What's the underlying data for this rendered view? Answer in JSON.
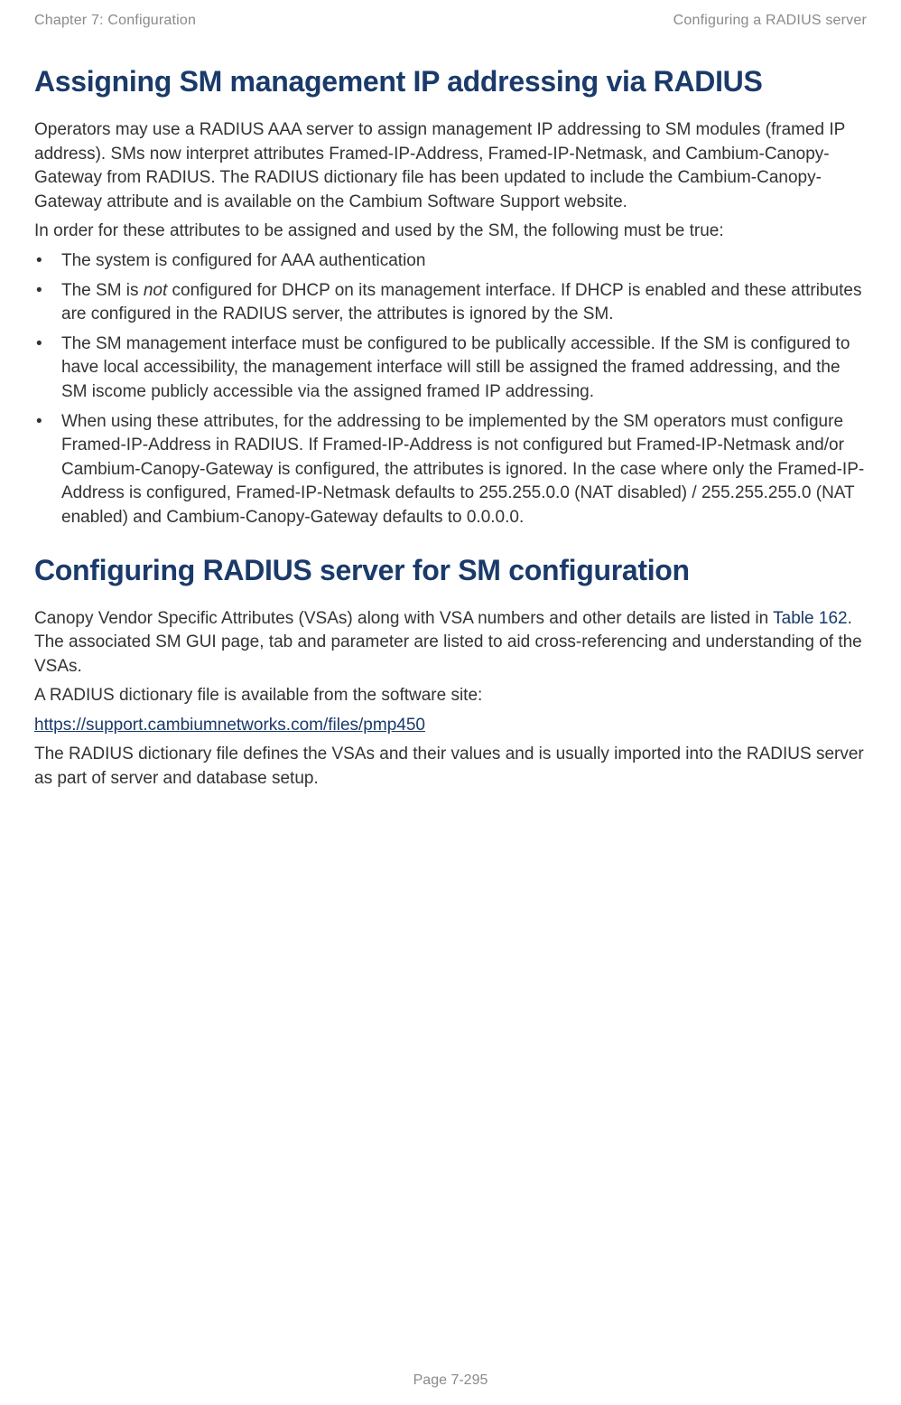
{
  "header": {
    "left": "Chapter 7:  Configuration",
    "right": "Configuring a RADIUS server"
  },
  "section1": {
    "title": "Assigning SM management IP addressing via RADIUS",
    "p1": "Operators may use a RADIUS AAA server to assign management IP addressing to SM modules (framed IP address). SMs now interpret attributes Framed-IP-Address, Framed-IP-Netmask, and Cambium-Canopy-Gateway from RADIUS. The RADIUS dictionary file has been updated to include the Cambium-Canopy-Gateway attribute and is available on the Cambium Software Support website.",
    "p2": "In order for these attributes to be assigned and used by the SM, the following must be true:",
    "bullets": {
      "b1": "The system is configured for AAA authentication",
      "b2a": "The SM is ",
      "b2i": "not",
      "b2b": " configured for DHCP on its management interface. If DHCP is enabled and these attributes are configured in the RADIUS server, the attributes is ignored by the SM.",
      "b3": "The SM management interface must be configured to be publically accessible. If the SM is configured to have local accessibility, the management interface will still be assigned the framed addressing, and the SM iscome publicly accessible via the assigned framed IP addressing.",
      "b4": "When using these attributes, for the addressing to be implemented by the SM operators must configure Framed-IP-Address in RADIUS. If Framed-IP-Address is not configured but Framed-IP-Netmask and/or Cambium-Canopy-Gateway is configured, the attributes is ignored. In the case where only the Framed-IP-Address is configured, Framed-IP-Netmask defaults to 255.255.0.0 (NAT disabled) / 255.255.255.0 (NAT enabled) and Cambium-Canopy-Gateway defaults to 0.0.0.0."
    }
  },
  "section2": {
    "title": "Configuring RADIUS server for SM configuration",
    "p1a": "Canopy Vendor Specific Attributes (VSAs) along with VSA numbers and other details are listed in ",
    "p1xref": "Table 162",
    "p1b": ". The associated SM GUI page, tab and parameter are listed to aid cross-referencing and understanding of the VSAs.",
    "p2": "A RADIUS dictionary file is available from the software site:",
    "link": "https://support.cambiumnetworks.com/files/pmp450",
    "p3": "The RADIUS dictionary file defines the VSAs and their values and is usually imported into the RADIUS server as part of server and database setup."
  },
  "footer": "Page 7-295"
}
